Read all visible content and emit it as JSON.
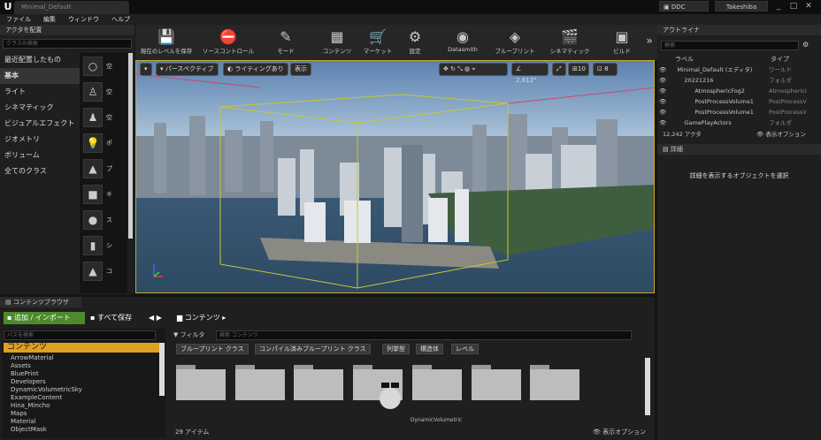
{
  "window": {
    "tab_title": "Minimal_Default",
    "ddc_label": "DDC",
    "user": "Takeshiba",
    "minimize": "_",
    "maximize": "□",
    "close": "✕"
  },
  "menu": [
    "ファイル",
    "編集",
    "ウィンドウ",
    "ヘルプ"
  ],
  "place_actors": {
    "title": "アクタを配置",
    "search_placeholder": "クラスの検索",
    "categories": [
      "最近配置したもの",
      "基本",
      "ライト",
      "シネマティック",
      "ビジュアルエフェクト",
      "ジオメトリ",
      "ボリューム",
      "全てのクラス"
    ],
    "active_index": 1,
    "items": [
      {
        "icon": "○",
        "label": "空"
      },
      {
        "icon": "♙",
        "label": "空"
      },
      {
        "icon": "♟",
        "label": "空"
      },
      {
        "icon": "💡",
        "label": "ポ"
      },
      {
        "icon": "▲",
        "label": "プ"
      },
      {
        "icon": "■",
        "label": "キ"
      },
      {
        "icon": "●",
        "label": "ス"
      },
      {
        "icon": "▮",
        "label": "シ"
      },
      {
        "icon": "▲",
        "label": "コ"
      }
    ]
  },
  "toolbar": {
    "items": [
      {
        "icon": "💾",
        "label": "現在のレベルを保存"
      },
      {
        "icon": "⛔",
        "label": "ソースコントロール"
      },
      {
        "icon": "✎",
        "label": "モード"
      },
      {
        "icon": "▦",
        "label": "コンテンツ"
      },
      {
        "icon": "🛒",
        "label": "マーケット"
      },
      {
        "icon": "⚙",
        "label": "設定"
      },
      {
        "icon": "◉",
        "label": "Datasmith"
      },
      {
        "icon": "◈",
        "label": "ブループリント"
      },
      {
        "icon": "🎬",
        "label": "シネマティック"
      },
      {
        "icon": "▣",
        "label": "ビルド"
      }
    ],
    "more": "»"
  },
  "viewport": {
    "perspective": "パースペクティブ",
    "lighting": "ライティングあり",
    "show": "表示",
    "fov_value": "2.812°",
    "grid_value": "10",
    "speed_value": "8"
  },
  "outliner": {
    "title": "アウトライナ",
    "search_placeholder": "検索",
    "col_label": "ラベル",
    "col_type": "タイプ",
    "rows": [
      {
        "name": "Minimal_Default (エディタ)",
        "type": "ワールド"
      },
      {
        "name": "20221216",
        "type": "フォルダ"
      },
      {
        "name": "AtmosphericFog2",
        "type": "AtmosphericI"
      },
      {
        "name": "PostProcessVolume1",
        "type": "PostProcessV"
      },
      {
        "name": "PostProcessVolume1",
        "type": "PostProcessV"
      },
      {
        "name": "GamePlayActors",
        "type": "フォルダ"
      }
    ],
    "actor_count": "12,242 アクタ",
    "view_options": "表示オプション"
  },
  "details": {
    "title": "詳細",
    "empty_message": "詳細を表示するオブジェクトを選択"
  },
  "content_browser": {
    "title": "コンテンツブラウザ",
    "add_import": "追加 / インポート",
    "save_all": "すべて保存",
    "path_root": "コンテンツ",
    "path_search_placeholder": "パスを検索",
    "filter_label": "フィルタ",
    "content_search_placeholder": "検索 コンテンツ",
    "filter_chips": [
      "ブループリント クラス",
      "コンパイル済みブループリント クラス",
      "列挙型",
      "構造体",
      "レベル"
    ],
    "tree": [
      "コンテンツ",
      "ArrowMaterial",
      "Assets",
      "BluePrint",
      "Developers",
      "DynamicVolumetricSky",
      "ExampleContent",
      "Hina_Mincho",
      "Maps",
      "Material",
      "ObjectMask"
    ],
    "folders": [
      "",
      "",
      "",
      "",
      "DynamicVolumetric",
      "",
      ""
    ],
    "item_count": "29 アイテム",
    "view_options": "表示オプション"
  }
}
